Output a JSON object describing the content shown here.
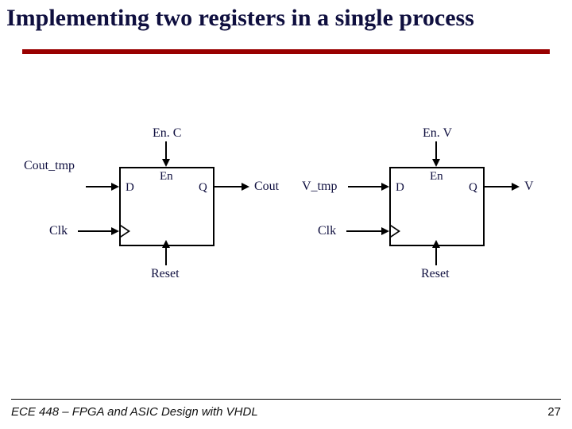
{
  "title": "Implementing two registers in a single process",
  "registers": [
    {
      "enable_top": "En. C",
      "input_sig": "Cout_tmp",
      "d_label": "D",
      "en_label": "En",
      "q_label": "Q",
      "output_sig": "Cout",
      "clk_sig": "Clk",
      "reset_sig": "Reset"
    },
    {
      "enable_top": "En. V",
      "input_sig": "V_tmp",
      "d_label": "D",
      "en_label": "En",
      "q_label": "Q",
      "output_sig": "V",
      "clk_sig": "Clk",
      "reset_sig": "Reset"
    }
  ],
  "footer_left": "ECE 448 – FPGA and ASIC Design with VHDL",
  "footer_right": "27"
}
